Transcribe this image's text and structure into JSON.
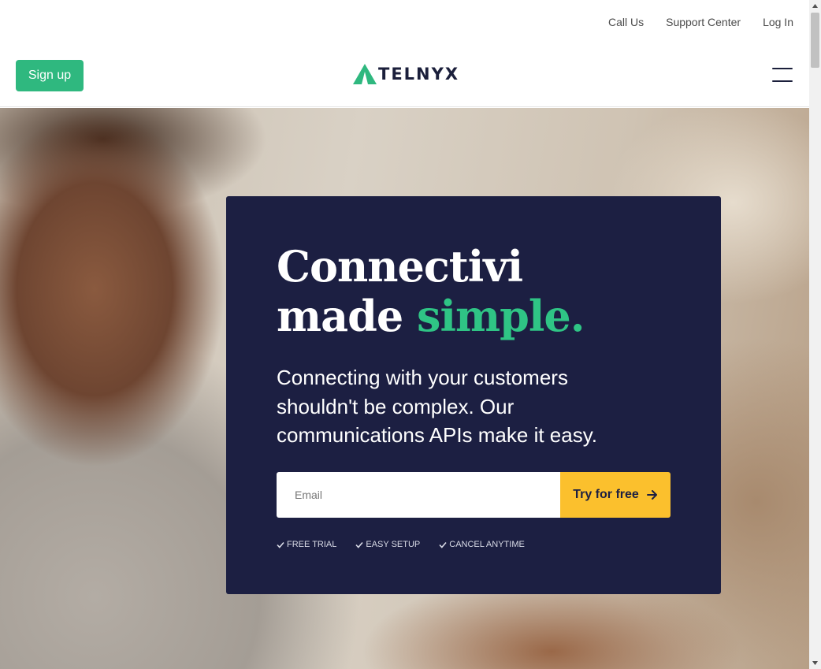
{
  "util_nav": {
    "items": [
      {
        "label": "Call Us"
      },
      {
        "label": "Support Center"
      },
      {
        "label": "Log In"
      }
    ]
  },
  "nav": {
    "signup_label": "Sign up",
    "logo_text": "TELNYX",
    "menu_icon": "hamburger-menu-icon"
  },
  "hero": {
    "headline_line1": "Connectivi",
    "headline_line2_prefix": "made ",
    "headline_line2_accent": "simple.",
    "subtext": "Connecting with your customers shouldn't be complex. Our communications APIs make it easy.",
    "email_placeholder": "Email",
    "email_value": "",
    "cta_label": "Try for free",
    "cta_icon": "arrow-right-icon",
    "features": [
      {
        "label": "FREE TRIAL",
        "icon": "check-icon"
      },
      {
        "label": "EASY SETUP",
        "icon": "check-icon"
      },
      {
        "label": "CANCEL ANYTIME",
        "icon": "check-icon"
      }
    ]
  },
  "colors": {
    "brand_green": "#2fb87f",
    "accent_green": "#2fc485",
    "card_navy": "#1c1f42",
    "cta_yellow": "#fbc02d"
  }
}
